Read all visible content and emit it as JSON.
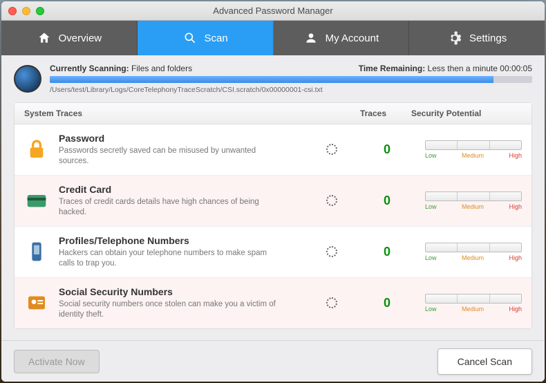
{
  "window": {
    "title": "Advanced Password Manager"
  },
  "tabs": [
    {
      "label": "Overview",
      "icon": "home-icon"
    },
    {
      "label": "Scan",
      "icon": "search-icon"
    },
    {
      "label": "My Account",
      "icon": "user-icon"
    },
    {
      "label": "Settings",
      "icon": "gear-icon"
    }
  ],
  "scan": {
    "status_label": "Currently Scanning:",
    "status_value": "Files and folders",
    "time_label": "Time Remaining:",
    "time_value": "Less then a minute 00:00:05",
    "path": "/Users/test/Library/Logs/CoreTelephonyTraceScratch/CSI.scratch/0x00000001-csi.txt",
    "progress_percent": 92
  },
  "columns": {
    "traces": "System Traces",
    "count": "Traces",
    "security": "Security Potential"
  },
  "rows": [
    {
      "title": "Password",
      "desc": "Passwords secretly saved can be misused by unwanted sources.",
      "count": "0",
      "icon": "lock-icon"
    },
    {
      "title": "Credit Card",
      "desc": "Traces of credit cards details have high chances of being hacked.",
      "count": "0",
      "icon": "card-icon"
    },
    {
      "title": "Profiles/Telephone Numbers",
      "desc": "Hackers can obtain your telephone numbers to make spam calls to trap you.",
      "count": "0",
      "icon": "phone-icon"
    },
    {
      "title": "Social Security Numbers",
      "desc": "Social security numbers once stolen can make you a victim of identity theft.",
      "count": "0",
      "icon": "id-icon"
    }
  ],
  "meter_labels": {
    "low": "Low",
    "medium": "Medium",
    "high": "High"
  },
  "buttons": {
    "activate": "Activate Now",
    "cancel": "Cancel Scan"
  }
}
